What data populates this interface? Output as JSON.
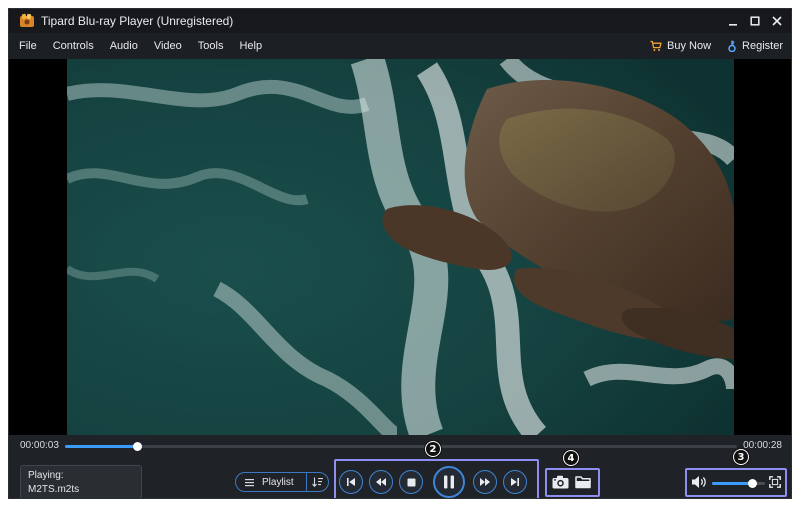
{
  "window": {
    "title": "Tipard Blu-ray Player (Unregistered)"
  },
  "menu": {
    "items": [
      "File",
      "Controls",
      "Audio",
      "Video",
      "Tools",
      "Help"
    ],
    "buy_now": "Buy Now",
    "register": "Register"
  },
  "player": {
    "time_current": "00:00:03",
    "time_total": "00:00:28",
    "progress_fraction": 0.107,
    "playing_label": "Playing:",
    "file_name": "M2TS.m2ts",
    "playlist_label": "Playlist",
    "volume_fraction": 0.75,
    "state": "playing"
  },
  "annotations": {
    "playback_controls": "2",
    "volume_controls": "3",
    "snapshot_folder": "4"
  },
  "icons": {
    "app": "tipard-logo-icon",
    "buy_now": "cart-icon",
    "register": "key-icon",
    "prev": "skip-previous-icon",
    "rewind": "rewind-icon",
    "stop": "stop-icon",
    "pause": "pause-icon",
    "forward": "fast-forward-icon",
    "next": "skip-next-icon",
    "snapshot": "camera-icon",
    "folder": "folder-icon",
    "volume": "volume-icon",
    "fullscreen": "fullscreen-icon"
  },
  "colors": {
    "accent": "#3c9bff",
    "highlight_box": "#8e8ff0",
    "window_bg": "#1a1d21"
  }
}
